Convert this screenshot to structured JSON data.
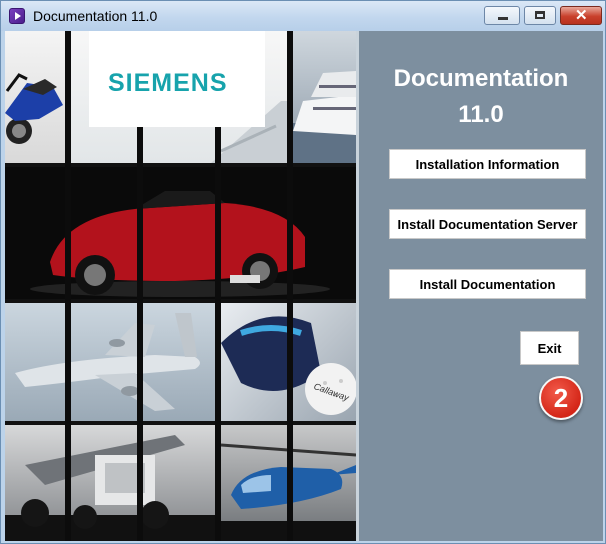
{
  "window": {
    "title": "Documentation 11.0",
    "controls": {
      "minimize": "minimize",
      "maximize": "maximize",
      "close": "✕"
    }
  },
  "branding": {
    "logo_text": "SIEMENS",
    "logo_color": "#17a3ac"
  },
  "panel": {
    "title_line1": "Documentation",
    "title_line2": "11.0",
    "background": "#7d8f9f"
  },
  "buttons": {
    "installation_information": "Installation Information",
    "install_documentation_server": "Install Documentation Server",
    "install_documentation": "Install Documentation",
    "exit": "Exit"
  },
  "callout": {
    "number": "2",
    "color": "#d42618"
  },
  "collage": {
    "tiles": [
      "motorcycle",
      "siemens-logo",
      "yacht",
      "sports-car",
      "cargo-plane",
      "golf-driver-and-ball",
      "industrial-machine",
      "helicopter"
    ],
    "golf_ball_text": "Callaway"
  }
}
